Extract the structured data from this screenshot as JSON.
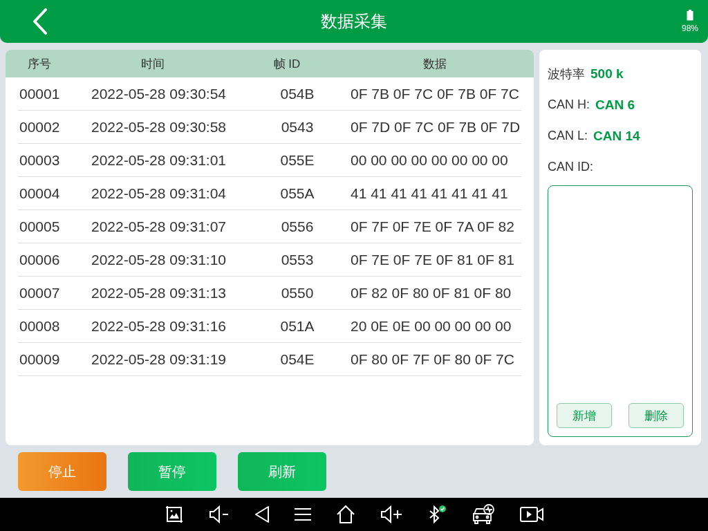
{
  "header": {
    "title": "数据采集",
    "battery": "98%"
  },
  "table": {
    "columns": [
      "序号",
      "时间",
      "帧 ID",
      "数据"
    ],
    "rows": [
      {
        "index": "00001",
        "time": "2022-05-28 09:30:54",
        "frame_id": "054B",
        "data": "0F 7B 0F 7C 0F 7B 0F 7C"
      },
      {
        "index": "00002",
        "time": "2022-05-28 09:30:58",
        "frame_id": "0543",
        "data": "0F 7D 0F 7C 0F 7B 0F 7D"
      },
      {
        "index": "00003",
        "time": "2022-05-28 09:31:01",
        "frame_id": "055E",
        "data": "00 00 00 00 00 00 00 00"
      },
      {
        "index": "00004",
        "time": "2022-05-28 09:31:04",
        "frame_id": "055A",
        "data": "41 41 41 41 41 41 41 41"
      },
      {
        "index": "00005",
        "time": "2022-05-28 09:31:07",
        "frame_id": "0556",
        "data": "0F 7F 0F 7E 0F 7A 0F 82"
      },
      {
        "index": "00006",
        "time": "2022-05-28 09:31:10",
        "frame_id": "0553",
        "data": "0F 7E 0F 7E 0F 81 0F 81"
      },
      {
        "index": "00007",
        "time": "2022-05-28 09:31:13",
        "frame_id": "0550",
        "data": "0F 82 0F 80 0F 81 0F 80"
      },
      {
        "index": "00008",
        "time": "2022-05-28 09:31:16",
        "frame_id": "051A",
        "data": "20 0E 0E 00 00 00 00 00"
      },
      {
        "index": "00009",
        "time": "2022-05-28 09:31:19",
        "frame_id": "054E",
        "data": "0F 80 0F 7F 0F 80 0F 7C"
      }
    ]
  },
  "settings": {
    "fields": [
      {
        "label": "波特率",
        "value": "500 k"
      },
      {
        "label": "CAN H:",
        "value": "CAN 6"
      },
      {
        "label": "CAN L:",
        "value": "CAN 14"
      }
    ],
    "can_id_label": "CAN ID:",
    "buttons": [
      "新增",
      "删除"
    ]
  },
  "actions": [
    {
      "label": "停止",
      "kind": "stop"
    },
    {
      "label": "暂停",
      "kind": "normal"
    },
    {
      "label": "刷新",
      "kind": "normal"
    }
  ]
}
